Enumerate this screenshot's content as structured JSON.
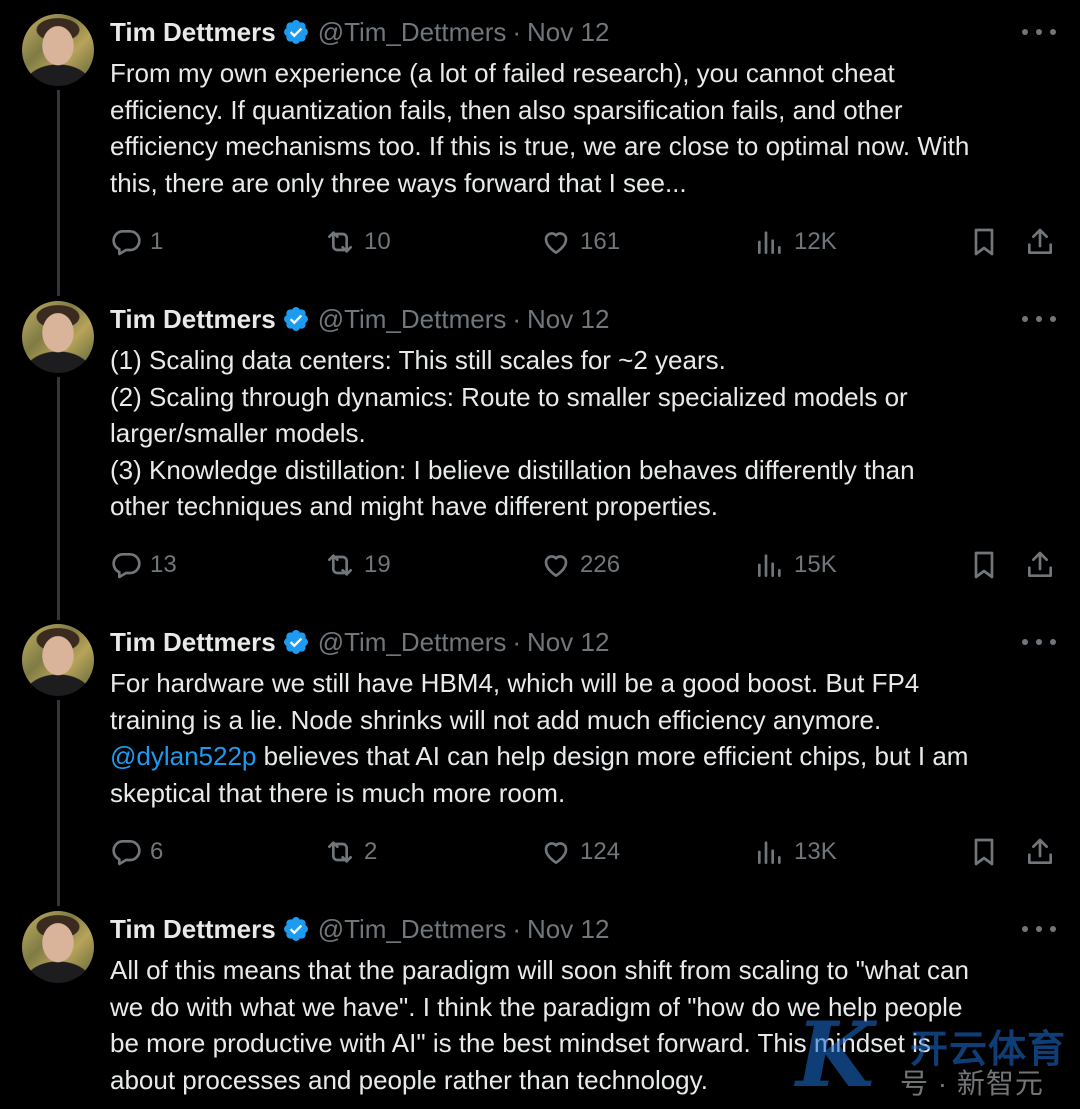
{
  "tweets": [
    {
      "author": "Tim Dettmers",
      "handle": "@Tim_Dettmers",
      "separator": "·",
      "date": "Nov 12",
      "text": "From my own experience (a lot of failed research), you cannot cheat\nefficiency. If quantization fails, then also sparsification fails, and other\nefficiency mechanisms too. If this is true, we are close to optimal now. With\nthis, there are only three ways forward that I see...",
      "replies": "1",
      "reposts": "10",
      "likes": "161",
      "views": "12K"
    },
    {
      "author": "Tim Dettmers",
      "handle": "@Tim_Dettmers",
      "separator": "·",
      "date": "Nov 12",
      "text": "(1) Scaling data centers: This still scales for ~2 years.\n(2) Scaling through dynamics: Route to smaller specialized models or\nlarger/smaller models.\n(3) Knowledge distillation: I believe distillation behaves differently than\nother techniques and might have different properties.",
      "replies": "13",
      "reposts": "19",
      "likes": "226",
      "views": "15K"
    },
    {
      "author": "Tim Dettmers",
      "handle": "@Tim_Dettmers",
      "separator": "·",
      "date": "Nov 12",
      "text_before": "For hardware we still have HBM4, which will be a good boost. But FP4\ntraining is a lie. Node shrinks will not add much efficiency anymore.\n",
      "mention": "@dylan522p",
      "text_after": " believes that AI can help design more efficient chips, but I am\nskeptical that there is much more room.",
      "replies": "6",
      "reposts": "2",
      "likes": "124",
      "views": "13K"
    },
    {
      "author": "Tim Dettmers",
      "handle": "@Tim_Dettmers",
      "separator": "·",
      "date": "Nov 12",
      "text": "All of this means that the paradigm will soon shift from scaling to \"what can\nwe do with what we have\". I think the paradigm of \"how do we help people\nbe more productive with AI\" is the best mindset forward. This mindset is\nabout processes and people rather than technology."
    }
  ],
  "watermark": {
    "logo_letter": "K",
    "brand": "开云体育",
    "sub": "号 · 新智元"
  },
  "icons": [
    "reply-icon",
    "repost-icon",
    "like-icon",
    "views-icon",
    "bookmark-icon",
    "share-icon",
    "verified-badge-icon",
    "more-icon"
  ],
  "colors": {
    "background": "#000000",
    "text": "#e7e9ea",
    "muted": "#71767b",
    "accent": "#1d9bf0",
    "thread_line": "#333639"
  }
}
